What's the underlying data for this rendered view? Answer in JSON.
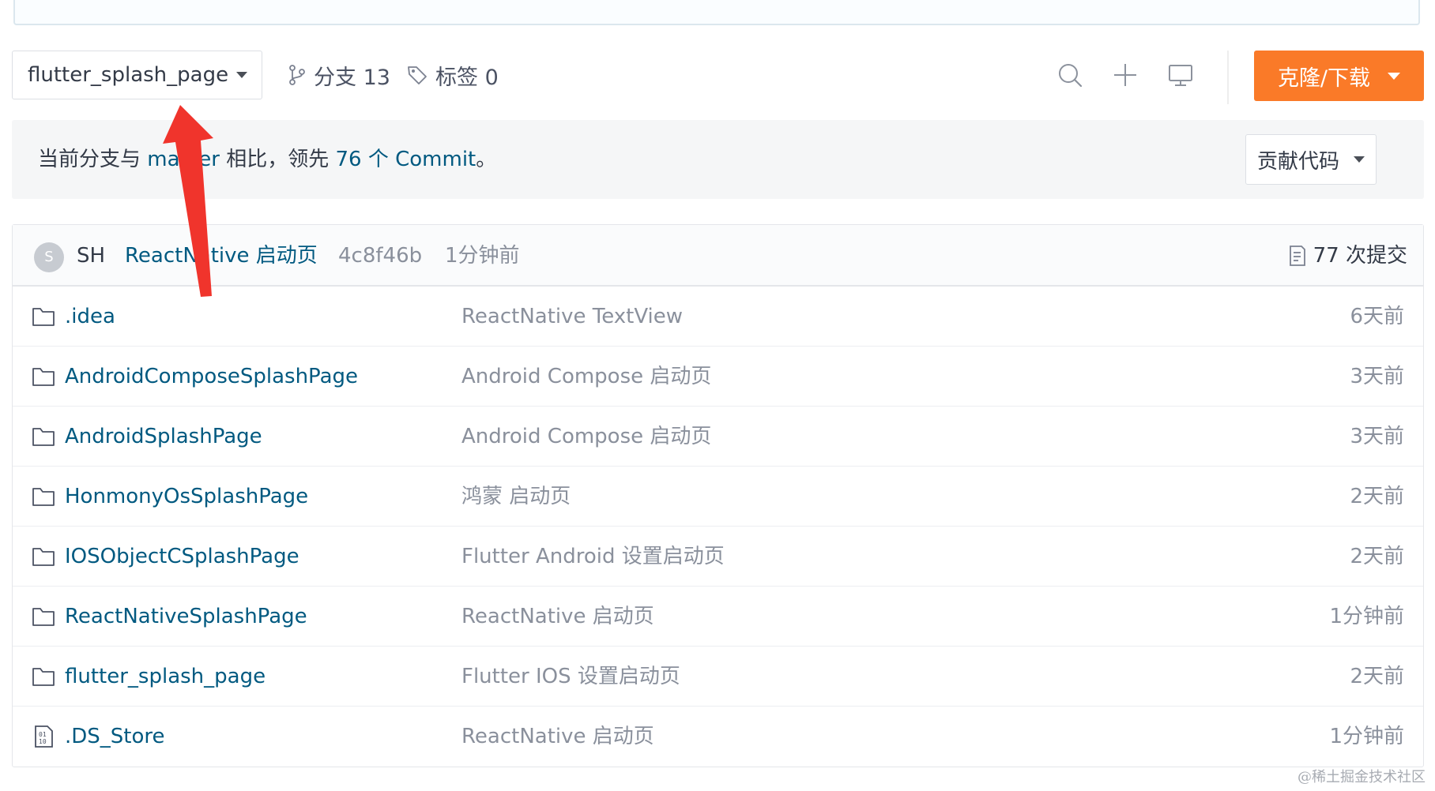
{
  "toolbar": {
    "branch_label": "flutter_splash_page",
    "branches_text": "分支 13",
    "tags_text": "标签 0",
    "clone_label": "克隆/下载",
    "icons": [
      "search-icon",
      "plus-icon",
      "monitor-icon"
    ]
  },
  "compare": {
    "prefix": "当前分支与 ",
    "base_branch": "master",
    "middle": " 相比，领先 ",
    "ahead": "76 个 Commit",
    "suffix": "。",
    "contribute_label": "贡献代码"
  },
  "commit": {
    "avatar_letter": "S",
    "author": "SH",
    "message": "ReactNative 启动页",
    "hash": "4c8f46b",
    "time": "1分钟前",
    "count_text": "77 次提交"
  },
  "files": [
    {
      "type": "folder",
      "name": ".idea",
      "message": "ReactNative TextView",
      "time": "6天前"
    },
    {
      "type": "folder",
      "name": "AndroidComposeSplashPage",
      "message": "Android Compose 启动页",
      "time": "3天前"
    },
    {
      "type": "folder",
      "name": "AndroidSplashPage",
      "message": "Android Compose 启动页",
      "time": "3天前"
    },
    {
      "type": "folder",
      "name": "HonmonyOsSplashPage",
      "message": "鸿蒙 启动页",
      "time": "2天前"
    },
    {
      "type": "folder",
      "name": "IOSObjectCSplashPage",
      "message": "Flutter Android 设置启动页",
      "time": "2天前"
    },
    {
      "type": "folder",
      "name": "ReactNativeSplashPage",
      "message": "ReactNative 启动页",
      "time": "1分钟前"
    },
    {
      "type": "folder",
      "name": "flutter_splash_page",
      "message": "Flutter IOS 设置启动页",
      "time": "2天前"
    },
    {
      "type": "file",
      "name": ".DS_Store",
      "message": "ReactNative 启动页",
      "time": "1分钟前"
    }
  ],
  "colors": {
    "accent_orange": "#fa7a28",
    "link_blue": "#005980",
    "annotation_red": "#f0342c"
  },
  "watermark": "@稀土掘金技术社区"
}
